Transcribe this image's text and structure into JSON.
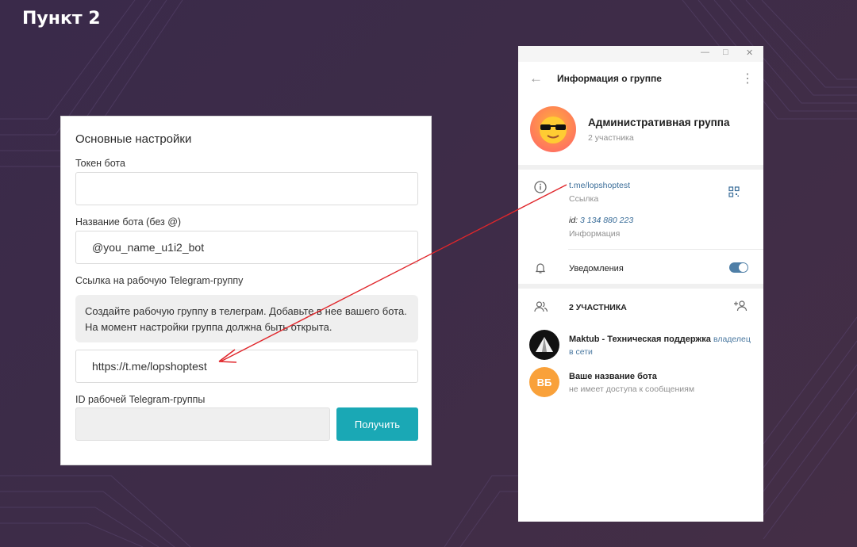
{
  "page": {
    "step_title": "Пункт 2"
  },
  "settings_panel": {
    "heading": "Основные настройки",
    "token_label": "Токен бота",
    "token_value": "",
    "bot_name_label": "Название бота (без @)",
    "bot_name_value": "@you_name_u1i2_bot",
    "group_link_label": "Ссылка на рабочую Telegram-группу",
    "hint_line1": "Создайте рабочую группу в телеграм. Добавьте в нее вашего бота.",
    "hint_line2": "На момент настройки группа должна быть открыта.",
    "group_link_value": "https://t.me/lopshoptest",
    "group_id_label": "ID рабочей Telegram-группы",
    "group_id_value": "",
    "get_button": "Получить"
  },
  "telegram_window": {
    "header_title": "Информация о группе",
    "group_name": "Административная группа",
    "group_members_count": "2 участника",
    "link_value": "t.me/lopshoptest",
    "link_caption": "Ссылка",
    "id_label": "id:",
    "id_value": "3 134 880 223",
    "id_caption": "Информация",
    "notifications_label": "Уведомления",
    "notifications_on": true,
    "members_title": "2 УЧАСТНИКА",
    "members": [
      {
        "name": "Maktub - Техническая поддержка",
        "status": "в сети",
        "role": "владелец"
      },
      {
        "initials": "ВБ",
        "name": "Ваше название бота",
        "status": "не имеет доступа к сообщениям"
      }
    ]
  },
  "colors": {
    "accent_teal": "#1aa8b5",
    "telegram_link": "#3a6d99",
    "arrow_red": "#e0262b",
    "background": "#3d2c48"
  }
}
